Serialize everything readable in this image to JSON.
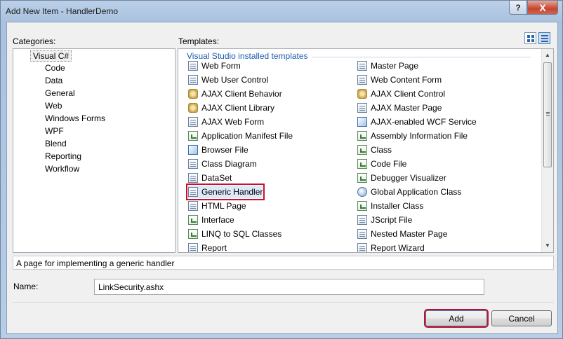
{
  "window": {
    "title": "Add New Item - HandlerDemo",
    "help_label": "?",
    "close_label": "X"
  },
  "labels": {
    "categories": "Categories:",
    "templates": "Templates:",
    "name": "Name:"
  },
  "categories": {
    "root": "Visual C#",
    "children": [
      "Code",
      "Data",
      "General",
      "Web",
      "Windows Forms",
      "WPF",
      "Blend",
      "Reporting",
      "Workflow"
    ]
  },
  "templates": {
    "group_title": "Visual Studio installed templates",
    "left": [
      {
        "label": "Web Form",
        "icon": "web-form-icon"
      },
      {
        "label": "Web User Control",
        "icon": "web-user-control-icon"
      },
      {
        "label": "AJAX Client Behavior",
        "icon": "ajax-client-behavior-icon"
      },
      {
        "label": "AJAX Client Library",
        "icon": "ajax-client-library-icon"
      },
      {
        "label": "AJAX Web Form",
        "icon": "ajax-web-form-icon"
      },
      {
        "label": "Application Manifest File",
        "icon": "manifest-file-icon"
      },
      {
        "label": "Browser File",
        "icon": "browser-file-icon"
      },
      {
        "label": "Class Diagram",
        "icon": "class-diagram-icon"
      },
      {
        "label": "DataSet",
        "icon": "dataset-icon"
      },
      {
        "label": "Generic Handler",
        "icon": "generic-handler-icon"
      },
      {
        "label": "HTML Page",
        "icon": "html-page-icon"
      },
      {
        "label": "Interface",
        "icon": "interface-icon"
      },
      {
        "label": "LINQ to SQL Classes",
        "icon": "linq-to-sql-icon"
      },
      {
        "label": "Report",
        "icon": "report-icon"
      }
    ],
    "right": [
      {
        "label": "Master Page",
        "icon": "master-page-icon"
      },
      {
        "label": "Web Content Form",
        "icon": "web-content-form-icon"
      },
      {
        "label": "AJAX Client Control",
        "icon": "ajax-client-control-icon"
      },
      {
        "label": "AJAX Master Page",
        "icon": "ajax-master-page-icon"
      },
      {
        "label": "AJAX-enabled WCF Service",
        "icon": "wcf-service-icon"
      },
      {
        "label": "Assembly Information File",
        "icon": "assembly-info-icon"
      },
      {
        "label": "Class",
        "icon": "class-icon"
      },
      {
        "label": "Code File",
        "icon": "code-file-icon"
      },
      {
        "label": "Debugger Visualizer",
        "icon": "debugger-visualizer-icon"
      },
      {
        "label": "Global Application Class",
        "icon": "global-application-icon"
      },
      {
        "label": "Installer Class",
        "icon": "installer-class-icon"
      },
      {
        "label": "JScript File",
        "icon": "jscript-file-icon"
      },
      {
        "label": "Nested Master Page",
        "icon": "nested-master-page-icon"
      },
      {
        "label": "Report Wizard",
        "icon": "report-wizard-icon"
      }
    ]
  },
  "description": "A page for implementing a generic handler",
  "name_value": "LinkSecurity.ashx",
  "buttons": {
    "add": "Add",
    "cancel": "Cancel"
  },
  "colors": {
    "highlight": "#c8102e",
    "group_title": "#1e5bb0"
  }
}
